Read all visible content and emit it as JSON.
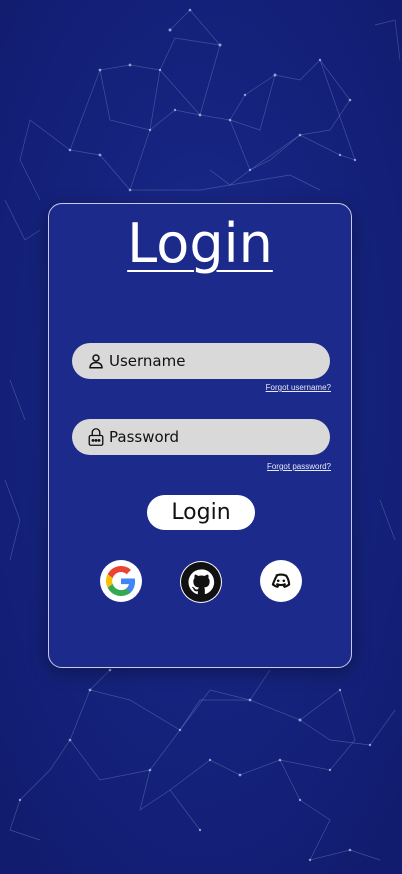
{
  "login_card": {
    "title": "Login",
    "username": {
      "placeholder": "Username",
      "forgot_link": "Forgot username?"
    },
    "password": {
      "placeholder": "Password",
      "forgot_link": "Forgot password?"
    },
    "submit_label": "Login",
    "social_logins": [
      "google-icon",
      "github-icon",
      "discord-icon"
    ]
  },
  "colors": {
    "background": "#14217a",
    "card": "#1c2a8c",
    "input": "#d9d9d9",
    "button": "#ffffff"
  }
}
